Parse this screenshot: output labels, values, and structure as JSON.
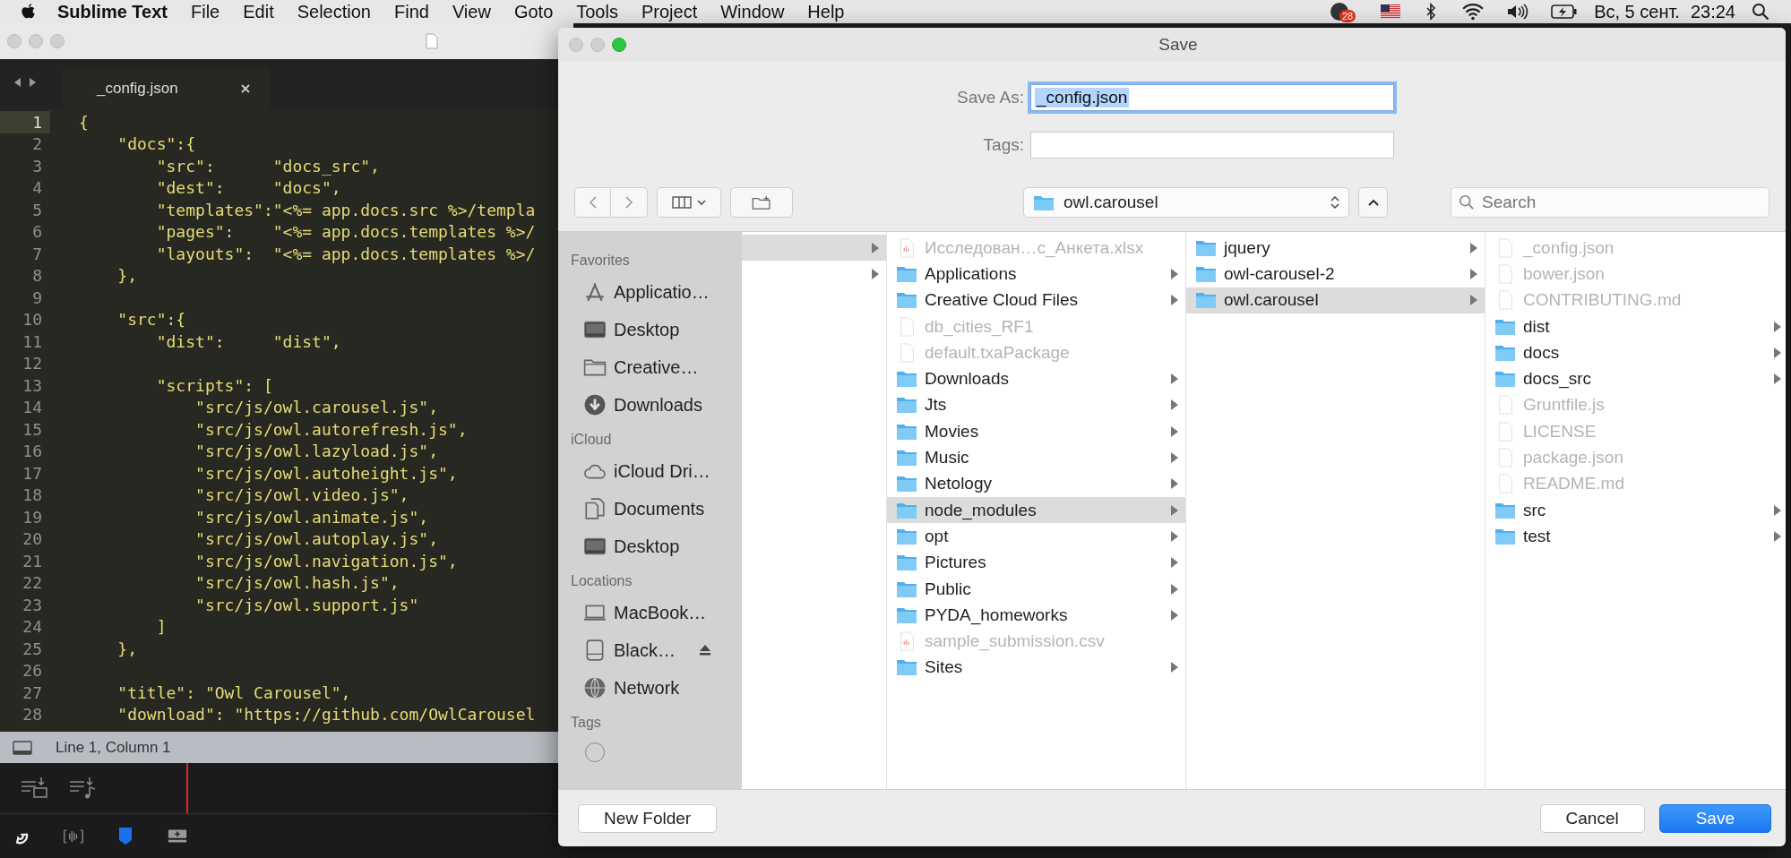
{
  "menubar": {
    "app": "Sublime Text",
    "menus": [
      "File",
      "Edit",
      "Selection",
      "Find",
      "View",
      "Goto",
      "Tools",
      "Project",
      "Window",
      "Help"
    ],
    "badge": "28",
    "date": "Вс, 5 сент.",
    "time": "23:24"
  },
  "editor": {
    "tabs": [
      {
        "label": "_config.json",
        "selected": true
      }
    ],
    "lines": [
      {
        "number": "1",
        "text": "{",
        "current": true
      },
      {
        "number": "2",
        "text": "    \"docs\":{",
        "current": false
      },
      {
        "number": "3",
        "text": "        \"src\":      \"docs_src\",",
        "current": false
      },
      {
        "number": "4",
        "text": "        \"dest\":     \"docs\",",
        "current": false
      },
      {
        "number": "5",
        "text": "        \"templates\":\"<%= app.docs.src %>/templa",
        "current": false
      },
      {
        "number": "6",
        "text": "        \"pages\":    \"<%= app.docs.templates %>/",
        "current": false
      },
      {
        "number": "7",
        "text": "        \"layouts\":  \"<%= app.docs.templates %>/",
        "current": false
      },
      {
        "number": "8",
        "text": "    },",
        "current": false
      },
      {
        "number": "9",
        "current": false
      },
      {
        "number": "10",
        "text": "    \"src\":{",
        "current": false
      },
      {
        "number": "11",
        "text": "        \"dist\":     \"dist\",",
        "current": false
      },
      {
        "number": "12",
        "current": false
      },
      {
        "number": "13",
        "text": "        \"scripts\": [",
        "current": false
      },
      {
        "number": "14",
        "text": "            \"src/js/owl.carousel.js\",",
        "current": false
      },
      {
        "number": "15",
        "text": "            \"src/js/owl.autorefresh.js\",",
        "current": false
      },
      {
        "number": "16",
        "text": "            \"src/js/owl.lazyload.js\",",
        "current": false
      },
      {
        "number": "17",
        "text": "            \"src/js/owl.autoheight.js\",",
        "current": false
      },
      {
        "number": "18",
        "text": "            \"src/js/owl.video.js\",",
        "current": false
      },
      {
        "number": "19",
        "text": "            \"src/js/owl.animate.js\",",
        "current": false
      },
      {
        "number": "20",
        "text": "            \"src/js/owl.autoplay.js\",",
        "current": false
      },
      {
        "number": "21",
        "text": "            \"src/js/owl.navigation.js\",",
        "current": false
      },
      {
        "number": "22",
        "text": "            \"src/js/owl.hash.js\",",
        "current": false
      },
      {
        "number": "23",
        "text": "            \"src/js/owl.support.js\"",
        "current": false
      },
      {
        "number": "24",
        "text": "        ]",
        "current": false
      },
      {
        "number": "25",
        "text": "    },",
        "current": false
      },
      {
        "number": "26",
        "current": false
      },
      {
        "number": "27",
        "text": "    \"title\": \"Owl Carousel\",",
        "current": false
      },
      {
        "number": "28",
        "text": "    \"download\": \"https://github.com/OwlCarousel",
        "current": false
      }
    ],
    "status": "Line 1, Column 1"
  },
  "dialog": {
    "title": "Save",
    "save_as": {
      "label": "Save As:",
      "value": "_config.json",
      "text_selected": true
    },
    "tags": {
      "label": "Tags:"
    },
    "location": "owl.carousel",
    "search": {
      "placeholder": "Search"
    },
    "sidebar": [
      {
        "heading": "Favorites",
        "items": [
          {
            "label": "Applicatio…",
            "kind": "apps"
          },
          {
            "label": "Desktop",
            "kind": "desktop"
          },
          {
            "label": "Creative…",
            "kind": "folder"
          },
          {
            "label": "Downloads",
            "kind": "download"
          }
        ]
      },
      {
        "heading": "iCloud",
        "items": [
          {
            "label": "iCloud Dri…",
            "kind": "cloud"
          },
          {
            "label": "Documents",
            "kind": "documents"
          },
          {
            "label": "Desktop",
            "kind": "desktop"
          }
        ]
      },
      {
        "heading": "Locations",
        "items": [
          {
            "label": "MacBook…",
            "kind": "laptop"
          },
          {
            "label": "Black…",
            "kind": "drive",
            "eject": true
          },
          {
            "label": "Network",
            "kind": "network"
          }
        ]
      },
      {
        "heading": "Tags"
      }
    ],
    "columns": [
      [
        {
          "kind": "hidden",
          "selected": true
        },
        {
          "kind": "hidden",
          "selected": false
        }
      ],
      [
        {
          "name": "Исследован…с_Анкета.xlsx",
          "kind": "sheet",
          "selected": false,
          "disabled": true
        },
        {
          "name": "Applications",
          "kind": "folder",
          "selected": false,
          "disabled": false
        },
        {
          "name": "Creative Cloud Files",
          "kind": "folder",
          "selected": false,
          "disabled": false
        },
        {
          "name": "db_cities_RF1",
          "kind": "file",
          "selected": false,
          "disabled": true
        },
        {
          "name": "default.txaPackage",
          "kind": "file",
          "selected": false,
          "disabled": true
        },
        {
          "name": "Downloads",
          "kind": "folder",
          "selected": false,
          "disabled": false
        },
        {
          "name": "Jts",
          "kind": "folder",
          "selected": false,
          "disabled": false
        },
        {
          "name": "Movies",
          "kind": "folder",
          "selected": false,
          "disabled": false
        },
        {
          "name": "Music",
          "kind": "folder",
          "selected": false,
          "disabled": false
        },
        {
          "name": "Netology",
          "kind": "folder",
          "selected": false,
          "disabled": false
        },
        {
          "name": "node_modules",
          "kind": "folder",
          "selected": true,
          "disabled": false
        },
        {
          "name": "opt",
          "kind": "folder",
          "selected": false,
          "disabled": false
        },
        {
          "name": "Pictures",
          "kind": "folder",
          "selected": false,
          "disabled": false
        },
        {
          "name": "Public",
          "kind": "folder",
          "selected": false,
          "disabled": false
        },
        {
          "name": "PYDA_homeworks",
          "kind": "folder",
          "selected": false,
          "disabled": false
        },
        {
          "name": "sample_submission.csv",
          "kind": "sheet",
          "selected": false,
          "disabled": true
        },
        {
          "name": "Sites",
          "kind": "folder",
          "selected": false,
          "disabled": false
        }
      ],
      [
        {
          "name": "jquery",
          "kind": "folder",
          "selected": false,
          "disabled": false
        },
        {
          "name": "owl-carousel-2",
          "kind": "folder",
          "selected": false,
          "disabled": false
        },
        {
          "name": "owl.carousel",
          "kind": "folder",
          "selected": true,
          "disabled": false
        }
      ],
      [
        {
          "name": "_config.json",
          "kind": "file",
          "selected": false,
          "disabled": true
        },
        {
          "name": "bower.json",
          "kind": "file",
          "selected": false,
          "disabled": true
        },
        {
          "name": "CONTRIBUTING.md",
          "kind": "file",
          "selected": false,
          "disabled": true
        },
        {
          "name": "dist",
          "kind": "folder",
          "selected": false,
          "disabled": false
        },
        {
          "name": "docs",
          "kind": "folder",
          "selected": false,
          "disabled": false
        },
        {
          "name": "docs_src",
          "kind": "folder",
          "selected": false,
          "disabled": false
        },
        {
          "name": "Gruntfile.js",
          "kind": "file",
          "selected": false,
          "disabled": true
        },
        {
          "name": "LICENSE",
          "kind": "file",
          "selected": false,
          "disabled": true
        },
        {
          "name": "package.json",
          "kind": "file",
          "selected": false,
          "disabled": true
        },
        {
          "name": "README.md",
          "kind": "file",
          "selected": false,
          "disabled": true
        },
        {
          "name": "src",
          "kind": "folder",
          "selected": false,
          "disabled": false
        },
        {
          "name": "test",
          "kind": "folder",
          "selected": false,
          "disabled": false
        }
      ]
    ],
    "buttons": [
      {
        "label": "New Folder",
        "kind": "left"
      },
      {
        "label": "Cancel",
        "kind": "plain"
      },
      {
        "label": "Save",
        "kind": "default"
      }
    ]
  }
}
